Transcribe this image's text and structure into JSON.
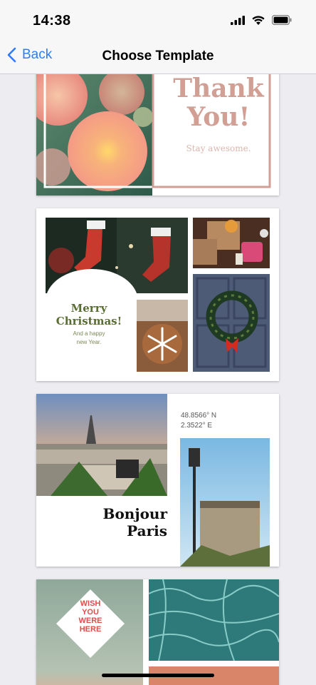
{
  "status_bar": {
    "time": "14:38"
  },
  "nav": {
    "back_label": "Back",
    "title": "Choose Template"
  },
  "templates": [
    {
      "title_line1": "Thank",
      "title_line2": "You!",
      "subtitle": "Stay awesome."
    },
    {
      "title_line1": "Merry",
      "title_line2": "Christmas!",
      "subtitle_line1": "And a happy",
      "subtitle_line2": "new Year."
    },
    {
      "coord_lat": "48.8566° N",
      "coord_lon": "2.3522° E",
      "title_line1": "Bonjour",
      "title_line2": "Paris"
    },
    {
      "badge_lines": [
        "WISH",
        "YOU",
        "WERE",
        "HERE"
      ]
    }
  ],
  "colors": {
    "accent": "#2f7cf6",
    "thank_you_pink": "#d29f94",
    "christmas_green": "#5a6d35",
    "wish_red": "#e04c4c"
  }
}
